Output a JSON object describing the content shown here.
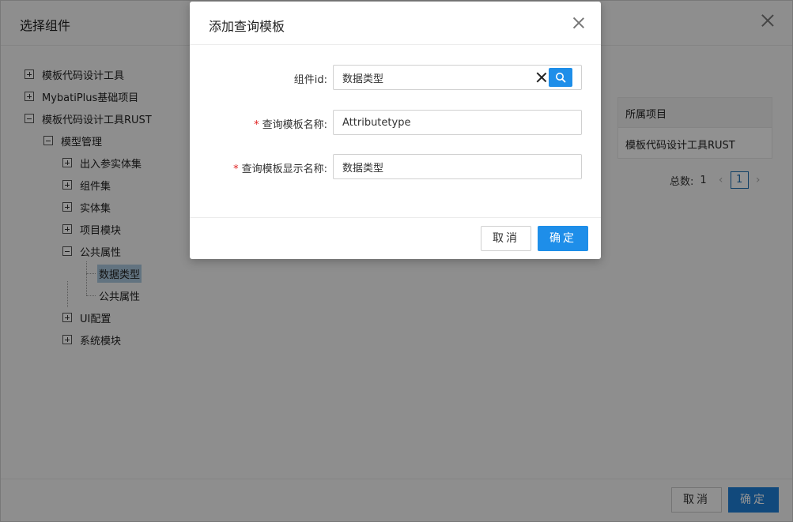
{
  "background_dialog": {
    "title": "选择组件",
    "tree": [
      {
        "label": "模板代码设计工具",
        "expanded": false
      },
      {
        "label": "MybatiPlus基础项目",
        "expanded": false
      },
      {
        "label": "模板代码设计工具RUST",
        "expanded": true
      },
      {
        "label": "模型管理",
        "expanded": true
      },
      {
        "label": "出入参实体集",
        "expanded": false
      },
      {
        "label": "组件集",
        "expanded": false
      },
      {
        "label": "实体集",
        "expanded": false
      },
      {
        "label": "项目模块",
        "expanded": false
      },
      {
        "label": "公共属性",
        "expanded": true
      },
      {
        "label": "数据类型",
        "selected": true
      },
      {
        "label": "公共属性"
      },
      {
        "label": "UI配置",
        "expanded": false
      },
      {
        "label": "系统模块",
        "expanded": false
      }
    ],
    "table": {
      "header": "所属项目",
      "cell": "模板代码设计工具RUST"
    },
    "pager": {
      "total_label": "总数:",
      "total": "1",
      "current_page": "1",
      "prev": "‹",
      "next": "›"
    },
    "cancel_label": "取消",
    "ok_label": "确定"
  },
  "modal": {
    "title": "添加查询模板",
    "fields": [
      {
        "label": "组件id:",
        "value": "数据类型",
        "required": false
      },
      {
        "label": "查询模板名称:",
        "value": "Attributetype",
        "required": true
      },
      {
        "label": "查询模板显示名称:",
        "value": "数据类型",
        "required": true
      }
    ],
    "required_mark": "*",
    "cancel_label": "取消",
    "ok_label": "确定"
  },
  "colors": {
    "primary": "#1e8ee9",
    "required": "#e02020"
  }
}
